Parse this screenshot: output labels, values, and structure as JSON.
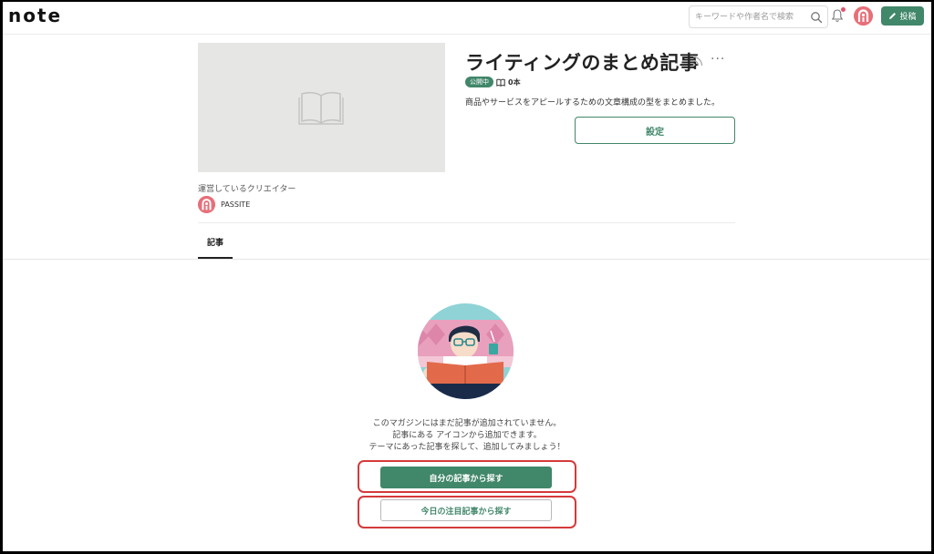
{
  "header": {
    "logo": "note",
    "search_placeholder": "キーワードや作者名で検索",
    "post_label": "投稿"
  },
  "magazine": {
    "title": "ライティングのまとめ記事",
    "status_badge": "公開中",
    "article_count": "0本",
    "description": "商品やサービスをアピールするための文章構成の型をまとめました。",
    "settings_label": "設定",
    "creators_label": "運営しているクリエイター",
    "creator_name": "PASSITE"
  },
  "tabs": [
    {
      "label": "記事"
    }
  ],
  "empty_state": {
    "line1": "このマガジンにはまだ記事が追加されていません。",
    "line2": "記事にある アイコンから追加できます。",
    "line3": "テーマにあった記事を探して、追加してみましょう！",
    "primary_button": "自分の記事から探す",
    "secondary_button": "今日の注目記事から探す"
  },
  "colors": {
    "accent": "#41876a",
    "highlight": "#d43a3a",
    "avatar": "#e76f78"
  }
}
